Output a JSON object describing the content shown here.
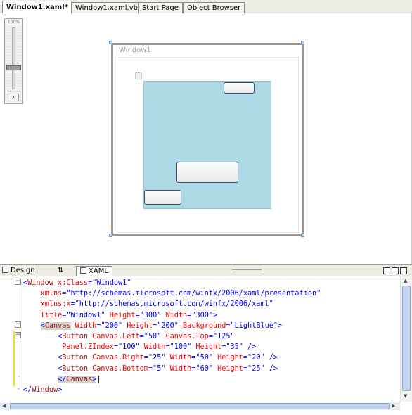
{
  "tabs": [
    "Window1.xaml*",
    "Window1.xaml.vb",
    "Start Page",
    "Object Browser"
  ],
  "zoom": {
    "label": "100%",
    "fit_icon": "zoom-to-fit-icon"
  },
  "design": {
    "window_title": "Window1",
    "canvas_color": "#add8e6"
  },
  "view_tabs": {
    "design": "Design",
    "swap": "⇅",
    "xaml": "XAML"
  },
  "pane_buttons": [
    "vertical-split-icon",
    "horizontal-split-icon",
    "collapse-pane-icon"
  ],
  "code": {
    "lines": [
      [
        [
          "t-d",
          "<"
        ],
        [
          "t-e",
          "Window"
        ],
        [
          "t-a",
          " x:Class"
        ],
        [
          "t-d",
          "=\""
        ],
        [
          "t-v",
          "Window1"
        ],
        [
          "t-d",
          "\""
        ]
      ],
      [
        [
          "",
          "    "
        ],
        [
          "t-a",
          "xmlns"
        ],
        [
          "t-d",
          "=\""
        ],
        [
          "t-v",
          "http://schemas.microsoft.com/winfx/2006/xaml/presentation"
        ],
        [
          "t-d",
          "\""
        ]
      ],
      [
        [
          "",
          "    "
        ],
        [
          "t-a",
          "xmlns:x"
        ],
        [
          "t-d",
          "=\""
        ],
        [
          "t-v",
          "http://schemas.microsoft.com/winfx/2006/xaml"
        ],
        [
          "t-d",
          "\""
        ]
      ],
      [
        [
          "",
          "    "
        ],
        [
          "t-a",
          "Title"
        ],
        [
          "t-d",
          "=\""
        ],
        [
          "t-v",
          "Window1"
        ],
        [
          "t-d",
          "\""
        ],
        [
          "t-a",
          " Height"
        ],
        [
          "t-d",
          "=\""
        ],
        [
          "t-v",
          "300"
        ],
        [
          "t-d",
          "\""
        ],
        [
          "t-a",
          " Width"
        ],
        [
          "t-d",
          "=\""
        ],
        [
          "t-v",
          "300"
        ],
        [
          "t-d",
          "\">"
        ]
      ],
      [
        [
          "",
          "    "
        ],
        [
          "t-d hl",
          "<"
        ],
        [
          "t-e hl",
          "Canvas"
        ],
        [
          "t-a",
          " Width"
        ],
        [
          "t-d",
          "=\""
        ],
        [
          "t-v",
          "200"
        ],
        [
          "t-d",
          "\""
        ],
        [
          "t-a",
          " Height"
        ],
        [
          "t-d",
          "=\""
        ],
        [
          "t-v",
          "200"
        ],
        [
          "t-d",
          "\""
        ],
        [
          "t-a",
          " Background"
        ],
        [
          "t-d",
          "=\""
        ],
        [
          "t-v",
          "LightBlue"
        ],
        [
          "t-d",
          "\">"
        ]
      ],
      [
        [
          "",
          "        "
        ],
        [
          "t-d",
          "<"
        ],
        [
          "t-e",
          "Button"
        ],
        [
          "t-a",
          " Canvas.Left"
        ],
        [
          "t-d",
          "=\""
        ],
        [
          "t-v",
          "50"
        ],
        [
          "t-d",
          "\""
        ],
        [
          "t-a",
          " Canvas.Top"
        ],
        [
          "t-d",
          "=\""
        ],
        [
          "t-v",
          "125"
        ],
        [
          "t-d",
          "\""
        ]
      ],
      [
        [
          "",
          "         "
        ],
        [
          "t-a",
          "Panel.ZIndex"
        ],
        [
          "t-d",
          "=\""
        ],
        [
          "t-v",
          "100"
        ],
        [
          "t-d",
          "\""
        ],
        [
          "t-a",
          " Width"
        ],
        [
          "t-d",
          "=\""
        ],
        [
          "t-v",
          "100"
        ],
        [
          "t-d",
          "\""
        ],
        [
          "t-a",
          " Height"
        ],
        [
          "t-d",
          "=\""
        ],
        [
          "t-v",
          "35"
        ],
        [
          "t-d",
          "\" />"
        ]
      ],
      [
        [
          "",
          "        "
        ],
        [
          "t-d",
          "<"
        ],
        [
          "t-e",
          "Button"
        ],
        [
          "t-a",
          " Canvas.Right"
        ],
        [
          "t-d",
          "=\""
        ],
        [
          "t-v",
          "25"
        ],
        [
          "t-d",
          "\""
        ],
        [
          "t-a",
          " Width"
        ],
        [
          "t-d",
          "=\""
        ],
        [
          "t-v",
          "50"
        ],
        [
          "t-d",
          "\""
        ],
        [
          "t-a",
          " Height"
        ],
        [
          "t-d",
          "=\""
        ],
        [
          "t-v",
          "20"
        ],
        [
          "t-d",
          "\" />"
        ]
      ],
      [
        [
          "",
          "        "
        ],
        [
          "t-d",
          "<"
        ],
        [
          "t-e",
          "Button"
        ],
        [
          "t-a",
          " Canvas.Bottom"
        ],
        [
          "t-d",
          "=\""
        ],
        [
          "t-v",
          "5"
        ],
        [
          "t-d",
          "\""
        ],
        [
          "t-a",
          " Width"
        ],
        [
          "t-d",
          "=\""
        ],
        [
          "t-v",
          "60"
        ],
        [
          "t-d",
          "\""
        ],
        [
          "t-a",
          " Height"
        ],
        [
          "t-d",
          "=\""
        ],
        [
          "t-v",
          "25"
        ],
        [
          "t-d",
          "\" />"
        ]
      ],
      [
        [
          "",
          "        "
        ],
        [
          "t-d hl",
          "</"
        ],
        [
          "t-e hl",
          "Canvas"
        ],
        [
          "t-d hl",
          ">"
        ],
        [
          "",
          "|"
        ]
      ],
      [
        [
          "t-d",
          "</"
        ],
        [
          "t-e",
          "Window"
        ],
        [
          "t-d",
          ">"
        ]
      ]
    ]
  }
}
